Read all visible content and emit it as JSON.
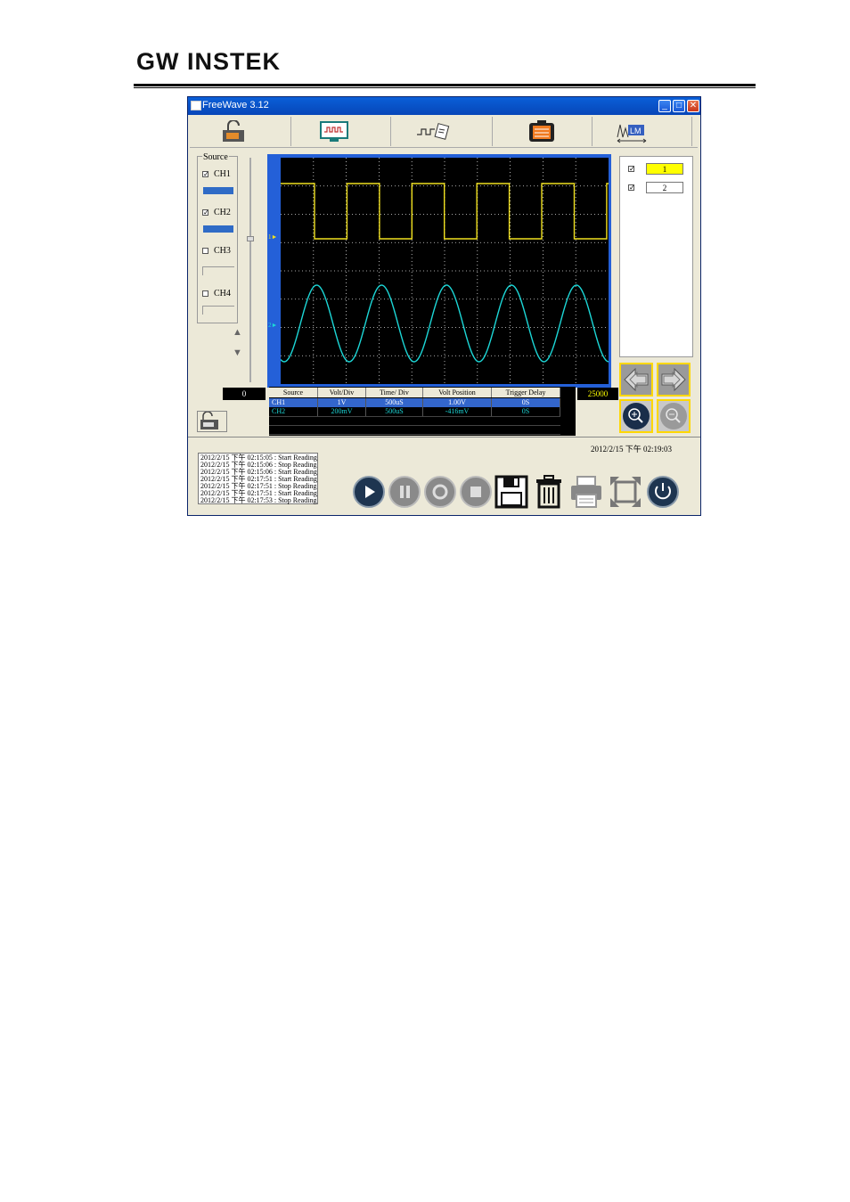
{
  "header": {
    "logo": "GW INSTEK"
  },
  "window": {
    "title": "FreeWave 3.12",
    "minimize": "_",
    "maximize": "□",
    "close": "✕"
  },
  "toolbar": {
    "items": [
      {
        "name": "lock-tool-icon"
      },
      {
        "name": "monitor-tool-icon"
      },
      {
        "name": "wave-tool-icon"
      },
      {
        "name": "memory-tool-icon"
      },
      {
        "name": "lm-tool-icon",
        "label": "LM"
      }
    ]
  },
  "source": {
    "legend": "Source",
    "channels": [
      {
        "label": "CH1",
        "checked": true,
        "check": "✓"
      },
      {
        "label": "CH2",
        "checked": true,
        "check": "✓"
      },
      {
        "label": "CH3",
        "checked": false,
        "check": ""
      },
      {
        "label": "CH4",
        "checked": false,
        "check": ""
      }
    ],
    "up_arrow": "▲",
    "down_arrow": "▼"
  },
  "scope": {
    "ch1_marker": "1►",
    "ch2_marker": "2►",
    "ch1_color": "#f0e020",
    "ch2_color": "#1cd7d7"
  },
  "waveform_list": [
    {
      "label": "1",
      "checked": true,
      "check": "✓",
      "bg": "#ffff00"
    },
    {
      "label": "2",
      "checked": true,
      "check": "✓",
      "bg": "#ffffff"
    }
  ],
  "range": {
    "left": "0",
    "right": "25000"
  },
  "table": {
    "headers": [
      "Source",
      "Volt/Div",
      "Time/ Div",
      "Volt Position",
      "Trigger Delay"
    ],
    "rows": [
      [
        "CH1",
        "1V",
        "500uS",
        "1.00V",
        "0S"
      ],
      [
        "CH2",
        "200mV",
        "500uS",
        "-416mV",
        "0S"
      ]
    ]
  },
  "status": {
    "datetime": "2012/2/15 下午 02:19:03"
  },
  "log": [
    "2012/2/15 下午 02:15:05 : Start Reading",
    "2012/2/15 下午 02:15:06 : Stop Reading",
    "2012/2/15 下午 02:15:06 : Start Reading",
    "2012/2/15 下午 02:17:51 : Start Reading",
    "2012/2/15 下午 02:17:51 : Stop Reading",
    "2012/2/15 下午 02:17:51 : Start Reading",
    "2012/2/15 下午 02:17:53 : Stop Reading"
  ],
  "controls": [
    "play-icon",
    "pause-icon",
    "record-icon",
    "stop-icon",
    "save-icon",
    "trash-icon",
    "print-icon",
    "fullscreen-icon",
    "power-icon"
  ]
}
